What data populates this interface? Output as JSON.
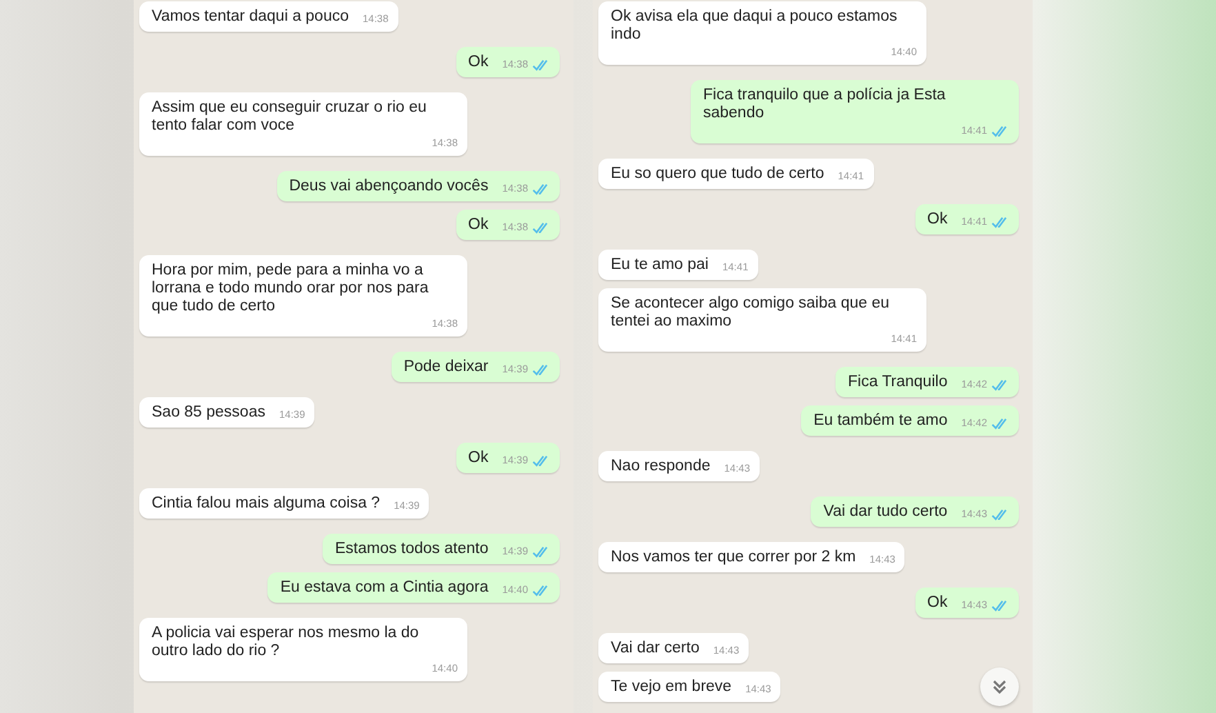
{
  "chats": [
    {
      "messages": [
        {
          "kind": "in",
          "text": "Vamos tentar daqui a pouco",
          "time": "14:38"
        },
        {
          "kind": "out",
          "text": "Ok",
          "time": "14:38"
        },
        {
          "kind": "in",
          "text": "Assim que eu conseguir cruzar o rio eu tento falar com voce",
          "time": "14:38"
        },
        {
          "kind": "out",
          "text": "Deus vai abençoando vocês",
          "time": "14:38"
        },
        {
          "kind": "out",
          "text": "Ok",
          "time": "14:38"
        },
        {
          "kind": "in",
          "text": "Hora por mim, pede para a minha vo a lorrana e todo mundo orar por nos para que tudo de certo",
          "time": "14:38"
        },
        {
          "kind": "out",
          "text": "Pode deixar",
          "time": "14:39"
        },
        {
          "kind": "in",
          "text": "Sao 85 pessoas",
          "time": "14:39"
        },
        {
          "kind": "out",
          "text": "Ok",
          "time": "14:39"
        },
        {
          "kind": "in",
          "text": "Cintia falou mais alguma coisa ?",
          "time": "14:39"
        },
        {
          "kind": "out",
          "text": "Estamos todos atento",
          "time": "14:39"
        },
        {
          "kind": "out",
          "text": "Eu estava com a Cintia agora",
          "time": "14:40"
        },
        {
          "kind": "in",
          "text": "A policia vai esperar nos mesmo la do outro lado do rio ?",
          "time": "14:40"
        }
      ]
    },
    {
      "messages": [
        {
          "kind": "in",
          "text": "Ok avisa ela que daqui a pouco estamos indo",
          "time": "14:40"
        },
        {
          "kind": "out",
          "text": "Fica tranquilo que a polícia ja Esta sabendo",
          "time": "14:41"
        },
        {
          "kind": "in",
          "text": "Eu so quero que tudo de certo",
          "time": "14:41"
        },
        {
          "kind": "out",
          "text": "Ok",
          "time": "14:41"
        },
        {
          "kind": "in",
          "text": "Eu te amo pai",
          "time": "14:41"
        },
        {
          "kind": "in",
          "text": "Se acontecer algo comigo saiba que eu tentei ao maximo",
          "time": "14:41"
        },
        {
          "kind": "out",
          "text": "Fica Tranquilo",
          "time": "14:42"
        },
        {
          "kind": "out",
          "text": "Eu também te amo",
          "time": "14:42"
        },
        {
          "kind": "in",
          "text": "Nao responde",
          "time": "14:43"
        },
        {
          "kind": "out",
          "text": "Vai dar tudo certo",
          "time": "14:43"
        },
        {
          "kind": "in",
          "text": "Nos vamos ter que correr por 2 km",
          "time": "14:43"
        },
        {
          "kind": "out",
          "text": "Ok",
          "time": "14:43"
        },
        {
          "kind": "in",
          "text": "Vai dar certo",
          "time": "14:43"
        },
        {
          "kind": "in",
          "text": "Te vejo em breve",
          "time": "14:43"
        }
      ]
    }
  ]
}
